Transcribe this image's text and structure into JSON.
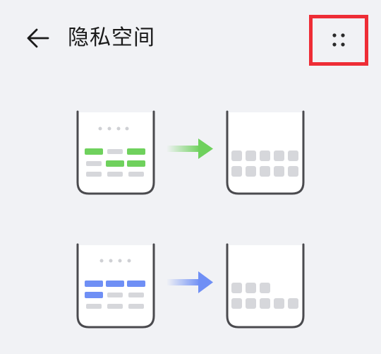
{
  "header": {
    "title": "隐私空间",
    "back_icon": "arrow-left-icon",
    "more_icon": "more-dots-icon"
  },
  "colors": {
    "background": "#f1f2f5",
    "highlight_border": "#ee2d36",
    "green_accent": "#6fd15d",
    "blue_accent": "#6f8ff5",
    "grey_block": "#d6d7db",
    "phone_outline": "#4a4a4e"
  },
  "illustrations": [
    {
      "name": "hide-apps-illustration",
      "accent": "green"
    },
    {
      "name": "hide-apps-alt-illustration",
      "accent": "blue"
    }
  ]
}
